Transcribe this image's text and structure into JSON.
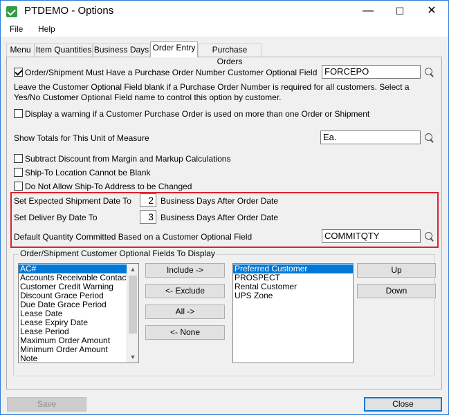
{
  "window": {
    "title": "PTDEMO - Options",
    "minimize": "—",
    "maximize": "☐",
    "close": "✕"
  },
  "menu": {
    "file": "File",
    "help": "Help"
  },
  "tabs": [
    {
      "label": "Menu"
    },
    {
      "label": "Item Quantities"
    },
    {
      "label": "Business Days"
    },
    {
      "label": "Order Entry"
    },
    {
      "label": "Purchase Orders"
    }
  ],
  "order_entry": {
    "po_required_label": "Order/Shipment Must Have a Purchase Order Number",
    "po_required_checked": true,
    "customer_optional_field_label": "Customer Optional Field",
    "customer_optional_field_value": "FORCEPO",
    "help_text": "Leave the Customer Optional Field blank if a Purchase Order Number is required for all customers. Select a Yes/No Customer Optional Field name to control this option by customer.",
    "warn_po_used_label": "Display a warning if a Customer Purchase Order is used on more than one Order or Shipment",
    "warn_po_used_checked": false,
    "show_totals_label": "Show Totals for This Unit of Measure",
    "show_totals_value": "Ea.",
    "subtract_discount_label": "Subtract Discount from Margin and Markup Calculations",
    "subtract_discount_checked": false,
    "shipto_not_blank_label": "Ship-To Location Cannot be Blank",
    "shipto_not_blank_checked": false,
    "no_shipto_change_label": "Do Not Allow Ship-To Address to be Changed",
    "no_shipto_change_checked": false,
    "expected_ship_label": "Set Expected Shipment Date To",
    "expected_ship_value": "2",
    "expected_ship_suffix": "Business Days After Order Date",
    "deliver_by_label": "Set Deliver By Date To",
    "deliver_by_value": "3",
    "deliver_by_suffix": "Business Days After Order Date",
    "default_qty_label": "Default Quantity Committed Based on a Customer Optional Field",
    "default_qty_value": "COMMITQTY"
  },
  "optional_fields": {
    "group_title": "Order/Shipment Customer Optional Fields To Display",
    "available": [
      "AC#",
      "Accounts Receivable Contact Type",
      "Customer Credit Warning",
      "Discount Grace Period",
      "Due Date Grace Period",
      "Lease Date",
      "Lease Expiry Date",
      "Lease Period",
      "Maximum Order Amount",
      "Minimum Order Amount",
      "Note"
    ],
    "selected": [
      "Preferred Customer",
      "PROSPECT",
      "Rental Customer",
      "UPS Zone"
    ],
    "include_btn": "Include ->",
    "exclude_btn": "<- Exclude",
    "all_btn": "All ->",
    "none_btn": "<- None",
    "up_btn": "Up",
    "down_btn": "Down"
  },
  "footer": {
    "save_btn": "Save",
    "close_btn": "Close"
  },
  "colors": {
    "highlight_border": "#e0202a",
    "selection": "#0078d7",
    "window_border": "#2b7bd6"
  }
}
